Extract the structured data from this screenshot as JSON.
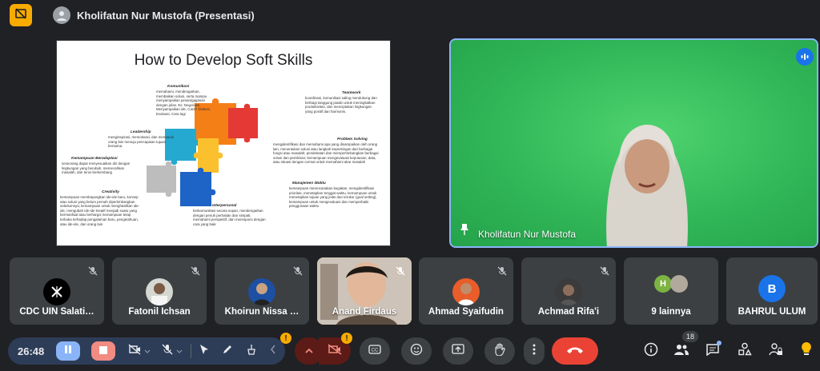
{
  "header": {
    "presenter_title": "Kholifatun Nur Mustofa (Presentasi)",
    "badge_color": "#f9ab00"
  },
  "slide": {
    "title": "How to Develop Soft Skills",
    "sections": {
      "komunikasi": {
        "label": "Komunikasi",
        "text": "memahami, mendengarkan, membaikan solusi, serta mampu menyampaikan pesan/gagasan dengan jelas. Ex: Negosiasi, Menyampaikan ide, Cara? Diskusi, Evaluasi, Cara lagi"
      },
      "teamwork": {
        "label": "Teamwork",
        "text": "koordinasi, komunikasi saling mendukung dan berbagi tanggung jawab untuk meningkatkan produktivitas, dan menciptakan lingkungan yang positif dan harmonis."
      },
      "leadership": {
        "label": "Leadership",
        "text": "menginspirasi, memotivasi, dan memandu orang lain menuju pencapaian tujuan bersama."
      },
      "problem_solving": {
        "label": "Problem Solving",
        "text": "mengidentifikasi dan memahami apa yang disampaikan oleh orang lain, menentukan solusi atau langkah kepentingan dari berbagai fungsi atau masalah; pendekatan dan mempertimbangkan berbagai solusi dan pemikiran; kemampuan mengevaluasi keputusan, data, atau situasi dengan cermat untuk memahami akar masalah"
      },
      "adaptasi": {
        "label": "Kemampuan Beradaptasi",
        "text": "seseorang dapat menyesuaikan diri dengan lingkungan yang berubah, memecahkan masalah, dan terus berkembang"
      },
      "kreativitas": {
        "label": "Creativity",
        "text": "kemampuan membayangkan ide-ide baru, konsep atau solusi yang belum pernah dipertimbangkan sebelumnya; kemampuan untuk menghasilkan ide-ide, mengubah ide-ide kreatif menjadi suatu yang bermanfaat atau berharga; kemampuan tetap terbuka terhadap pengalaman baru, pengetahuan, atau ide-ide, dan orang lain"
      },
      "interpersonal": {
        "label": "Interpersonal",
        "text": "berkomunikasi secara sopan, mendengarkan dengan penuh perhatian dan simpati, memahami perspektif, dan merespons dengan cara yang baik"
      },
      "manajemen_waktu": {
        "label": "Manajemen Waktu",
        "text": "kemampuan merencanakan kegiatan, mengidentifikasi prioritas, menetapkan tenggat waktu, kemampuan untuk menetapkan tujuan yang jelas dan terukur (goal setting), kemampuan untuk mengevaluasi dan memperbaiki penggunaan waktu"
      }
    }
  },
  "speaker": {
    "name": "Kholifatun Nur Mustofa",
    "bg_color": "#35bf5c",
    "border_color": "#8ab4f8"
  },
  "participants": [
    {
      "name": "CDC UIN Salati…",
      "avatar": "logo-x",
      "muted": true
    },
    {
      "name": "Fatonil Ichsan",
      "avatar": "photo",
      "muted": true
    },
    {
      "name": "Khoirun Nissa …",
      "avatar": "photo",
      "muted": true
    },
    {
      "name": "Anand Firdaus",
      "avatar": "video",
      "muted": true
    },
    {
      "name": "Ahmad Syaifudin",
      "avatar": "photo",
      "muted": true
    },
    {
      "name": "Achmad Rifa'i",
      "avatar": "photo",
      "muted": true
    },
    {
      "name": "9 lainnya",
      "avatar": "group",
      "initial": "H"
    },
    {
      "name": "BAHRUL ULUM",
      "avatar": "initial",
      "initial": "B"
    }
  ],
  "toolbar": {
    "time": "26:48",
    "participant_count": "18",
    "warn_glyph": "!",
    "colors": {
      "end_call": "#ea4335",
      "pause": "#8ab4f8",
      "stop": "#f28b82",
      "mute_active": "#5c1b16"
    }
  }
}
